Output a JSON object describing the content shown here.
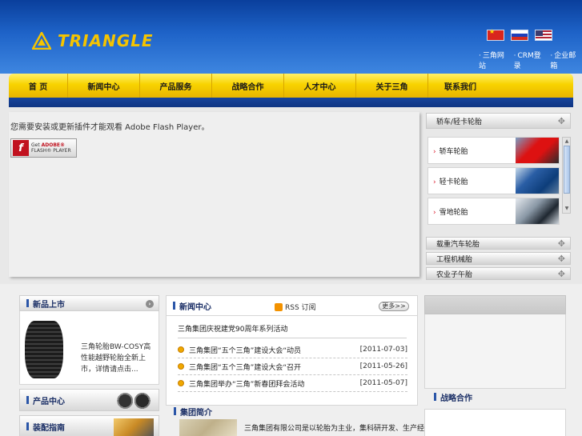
{
  "header": {
    "logo_text": "TRIANGLE",
    "flags": [
      "chinese",
      "russian",
      "english"
    ],
    "toplinks": [
      {
        "label": "三角网站"
      },
      {
        "label": "CRM登录"
      },
      {
        "label": "企业邮箱"
      }
    ]
  },
  "nav": {
    "items": [
      {
        "label": "首 页"
      },
      {
        "label": "新闻中心"
      },
      {
        "label": "产品服务"
      },
      {
        "label": "战略合作"
      },
      {
        "label": "人才中心"
      },
      {
        "label": "关于三角"
      },
      {
        "label": "联系我们"
      }
    ]
  },
  "flash": {
    "message": "您需要安装或更新插件才能观看 Adobe Flash Player。",
    "button_line1_pre": "Get ",
    "button_line1_brand": "ADOBE®",
    "button_line2": "FLASH® PLAYER"
  },
  "sidebar": {
    "title": "轿车/轻卡轮胎",
    "items": [
      {
        "label": "轿车轮胎"
      },
      {
        "label": "轻卡轮胎"
      },
      {
        "label": "雪地轮胎"
      }
    ],
    "rows": [
      {
        "label": "载重汽车轮胎"
      },
      {
        "label": "工程机械胎"
      },
      {
        "label": "农业子午胎"
      }
    ]
  },
  "new_product": {
    "title": "新品上市",
    "text": "三角轮胎BW-COSY高性能越野轮胎全新上市，详情请点击..."
  },
  "side_buttons": [
    {
      "label": "产品中心"
    },
    {
      "label": "装配指南"
    }
  ],
  "news": {
    "title": "新闻中心",
    "rss_label": "RSS 订阅",
    "more_label": "更多>>",
    "headline": "三角集团庆祝建党90周年系列活动",
    "items": [
      {
        "title": "三角集团“五个三角”建设大会“动员",
        "date": "[2011-07-03]"
      },
      {
        "title": "三角集团“五个三角”建设大会“召开",
        "date": "[2011-05-26]"
      },
      {
        "title": "三角集团举办“三角”新春团拜会活动",
        "date": "[2011-05-07]"
      }
    ]
  },
  "intro": {
    "title": "集团简介",
    "text": "三角集团有限公司是以轮胎为主业，集科研开发、生产经营、进出口为一体"
  },
  "partner": {
    "title": "战略合作"
  }
}
